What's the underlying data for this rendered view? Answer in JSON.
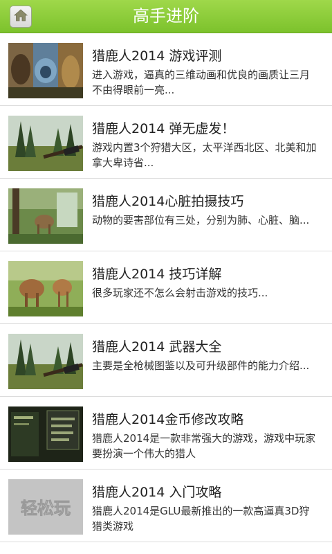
{
  "header": {
    "title": "高手进阶",
    "home_icon": "home-icon"
  },
  "articles": [
    {
      "title": "猎鹿人2014 游戏评测",
      "desc": "进入游戏，逼真的三维动画和优良的画质让三月不由得眼前一亮..."
    },
    {
      "title": "猎鹿人2014 弹无虚发！",
      "desc": "游戏内置3个狩猎大区，太平洋西北区、北美和加拿大卑诗省..."
    },
    {
      "title": "猎鹿人2014心脏拍摄技巧",
      "desc": "动物的要害部位有三处，分别为肺、心脏、脑..."
    },
    {
      "title": "猎鹿人2014 技巧详解",
      "desc": "很多玩家还不怎么会射击游戏的技巧..."
    },
    {
      "title": "猎鹿人2014 武器大全",
      "desc": "主要是全枪械图鉴以及可升级部件的能力介绍..."
    },
    {
      "title": "猎鹿人2014金币修改攻略",
      "desc": "猎鹿人2014是一款非常强大的游戏，游戏中玩家要扮演一个伟大的猎人"
    },
    {
      "title": "猎鹿人2014 入门攻略",
      "desc": "猎鹿人2014是GLU最新推出的一款高逼真3D狩猎类游戏",
      "thumb_text": "轻松玩"
    }
  ],
  "colors": {
    "header_green": "#86c934",
    "divider": "#dcdcdc"
  }
}
